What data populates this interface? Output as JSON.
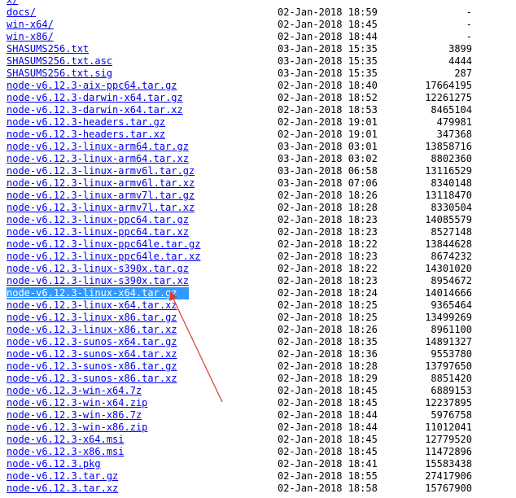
{
  "colors": {
    "link": "#0000ee",
    "selection": "#3399ff",
    "annotation_arrow": "#e03a2e"
  },
  "rows": [
    {
      "name": "x/",
      "date": "",
      "size": ""
    },
    {
      "name": "docs/",
      "date": "02-Jan-2018 18:59",
      "size": "-"
    },
    {
      "name": "win-x64/",
      "date": "02-Jan-2018 18:45",
      "size": "-"
    },
    {
      "name": "win-x86/",
      "date": "02-Jan-2018 18:44",
      "size": "-"
    },
    {
      "name": "SHASUMS256.txt",
      "date": "03-Jan-2018 15:35",
      "size": "3899"
    },
    {
      "name": "SHASUMS256.txt.asc",
      "date": "03-Jan-2018 15:35",
      "size": "4444"
    },
    {
      "name": "SHASUMS256.txt.sig",
      "date": "03-Jan-2018 15:35",
      "size": "287"
    },
    {
      "name": "node-v6.12.3-aix-ppc64.tar.gz",
      "date": "02-Jan-2018 18:40",
      "size": "17664195"
    },
    {
      "name": "node-v6.12.3-darwin-x64.tar.gz",
      "date": "02-Jan-2018 18:52",
      "size": "12261275"
    },
    {
      "name": "node-v6.12.3-darwin-x64.tar.xz",
      "date": "02-Jan-2018 18:53",
      "size": "8465104"
    },
    {
      "name": "node-v6.12.3-headers.tar.gz",
      "date": "02-Jan-2018 19:01",
      "size": "479981"
    },
    {
      "name": "node-v6.12.3-headers.tar.xz",
      "date": "02-Jan-2018 19:01",
      "size": "347368"
    },
    {
      "name": "node-v6.12.3-linux-arm64.tar.gz",
      "date": "03-Jan-2018 03:01",
      "size": "13858716"
    },
    {
      "name": "node-v6.12.3-linux-arm64.tar.xz",
      "date": "03-Jan-2018 03:02",
      "size": "8802360"
    },
    {
      "name": "node-v6.12.3-linux-armv6l.tar.gz",
      "date": "03-Jan-2018 06:58",
      "size": "13116529"
    },
    {
      "name": "node-v6.12.3-linux-armv6l.tar.xz",
      "date": "03-Jan-2018 07:06",
      "size": "8340148"
    },
    {
      "name": "node-v6.12.3-linux-armv7l.tar.gz",
      "date": "02-Jan-2018 18:26",
      "size": "13118470"
    },
    {
      "name": "node-v6.12.3-linux-armv7l.tar.xz",
      "date": "02-Jan-2018 18:28",
      "size": "8330504"
    },
    {
      "name": "node-v6.12.3-linux-ppc64.tar.gz",
      "date": "02-Jan-2018 18:23",
      "size": "14085579"
    },
    {
      "name": "node-v6.12.3-linux-ppc64.tar.xz",
      "date": "02-Jan-2018 18:23",
      "size": "8527148"
    },
    {
      "name": "node-v6.12.3-linux-ppc64le.tar.gz",
      "date": "02-Jan-2018 18:22",
      "size": "13844628"
    },
    {
      "name": "node-v6.12.3-linux-ppc64le.tar.xz",
      "date": "02-Jan-2018 18:23",
      "size": "8674232"
    },
    {
      "name": "node-v6.12.3-linux-s390x.tar.gz",
      "date": "02-Jan-2018 18:22",
      "size": "14301020"
    },
    {
      "name": "node-v6.12.3-linux-s390x.tar.xz",
      "date": "02-Jan-2018 18:23",
      "size": "8954672"
    },
    {
      "name": "node-v6.12.3-linux-x64.tar.gz",
      "date": "02-Jan-2018 18:24",
      "size": "14014666",
      "selected": true
    },
    {
      "name": "node-v6.12.3-linux-x64.tar.xz",
      "date": "02-Jan-2018 18:25",
      "size": "9365464"
    },
    {
      "name": "node-v6.12.3-linux-x86.tar.gz",
      "date": "02-Jan-2018 18:25",
      "size": "13499269"
    },
    {
      "name": "node-v6.12.3-linux-x86.tar.xz",
      "date": "02-Jan-2018 18:26",
      "size": "8961100"
    },
    {
      "name": "node-v6.12.3-sunos-x64.tar.gz",
      "date": "02-Jan-2018 18:35",
      "size": "14891327"
    },
    {
      "name": "node-v6.12.3-sunos-x64.tar.xz",
      "date": "02-Jan-2018 18:36",
      "size": "9553780"
    },
    {
      "name": "node-v6.12.3-sunos-x86.tar.gz",
      "date": "02-Jan-2018 18:28",
      "size": "13797650"
    },
    {
      "name": "node-v6.12.3-sunos-x86.tar.xz",
      "date": "02-Jan-2018 18:29",
      "size": "8851420"
    },
    {
      "name": "node-v6.12.3-win-x64.7z",
      "date": "02-Jan-2018 18:45",
      "size": "6889153"
    },
    {
      "name": "node-v6.12.3-win-x64.zip",
      "date": "02-Jan-2018 18:45",
      "size": "12237895"
    },
    {
      "name": "node-v6.12.3-win-x86.7z",
      "date": "02-Jan-2018 18:44",
      "size": "5976758"
    },
    {
      "name": "node-v6.12.3-win-x86.zip",
      "date": "02-Jan-2018 18:44",
      "size": "11012041"
    },
    {
      "name": "node-v6.12.3-x64.msi",
      "date": "02-Jan-2018 18:45",
      "size": "12779520"
    },
    {
      "name": "node-v6.12.3-x86.msi",
      "date": "02-Jan-2018 18:45",
      "size": "11472896"
    },
    {
      "name": "node-v6.12.3.pkg",
      "date": "02-Jan-2018 18:41",
      "size": "15583438"
    },
    {
      "name": "node-v6.12.3.tar.gz",
      "date": "02-Jan-2018 18:55",
      "size": "27417906"
    },
    {
      "name": "node-v6.12.3.tar.xz",
      "date": "02-Jan-2018 18:58",
      "size": "15767900"
    }
  ]
}
